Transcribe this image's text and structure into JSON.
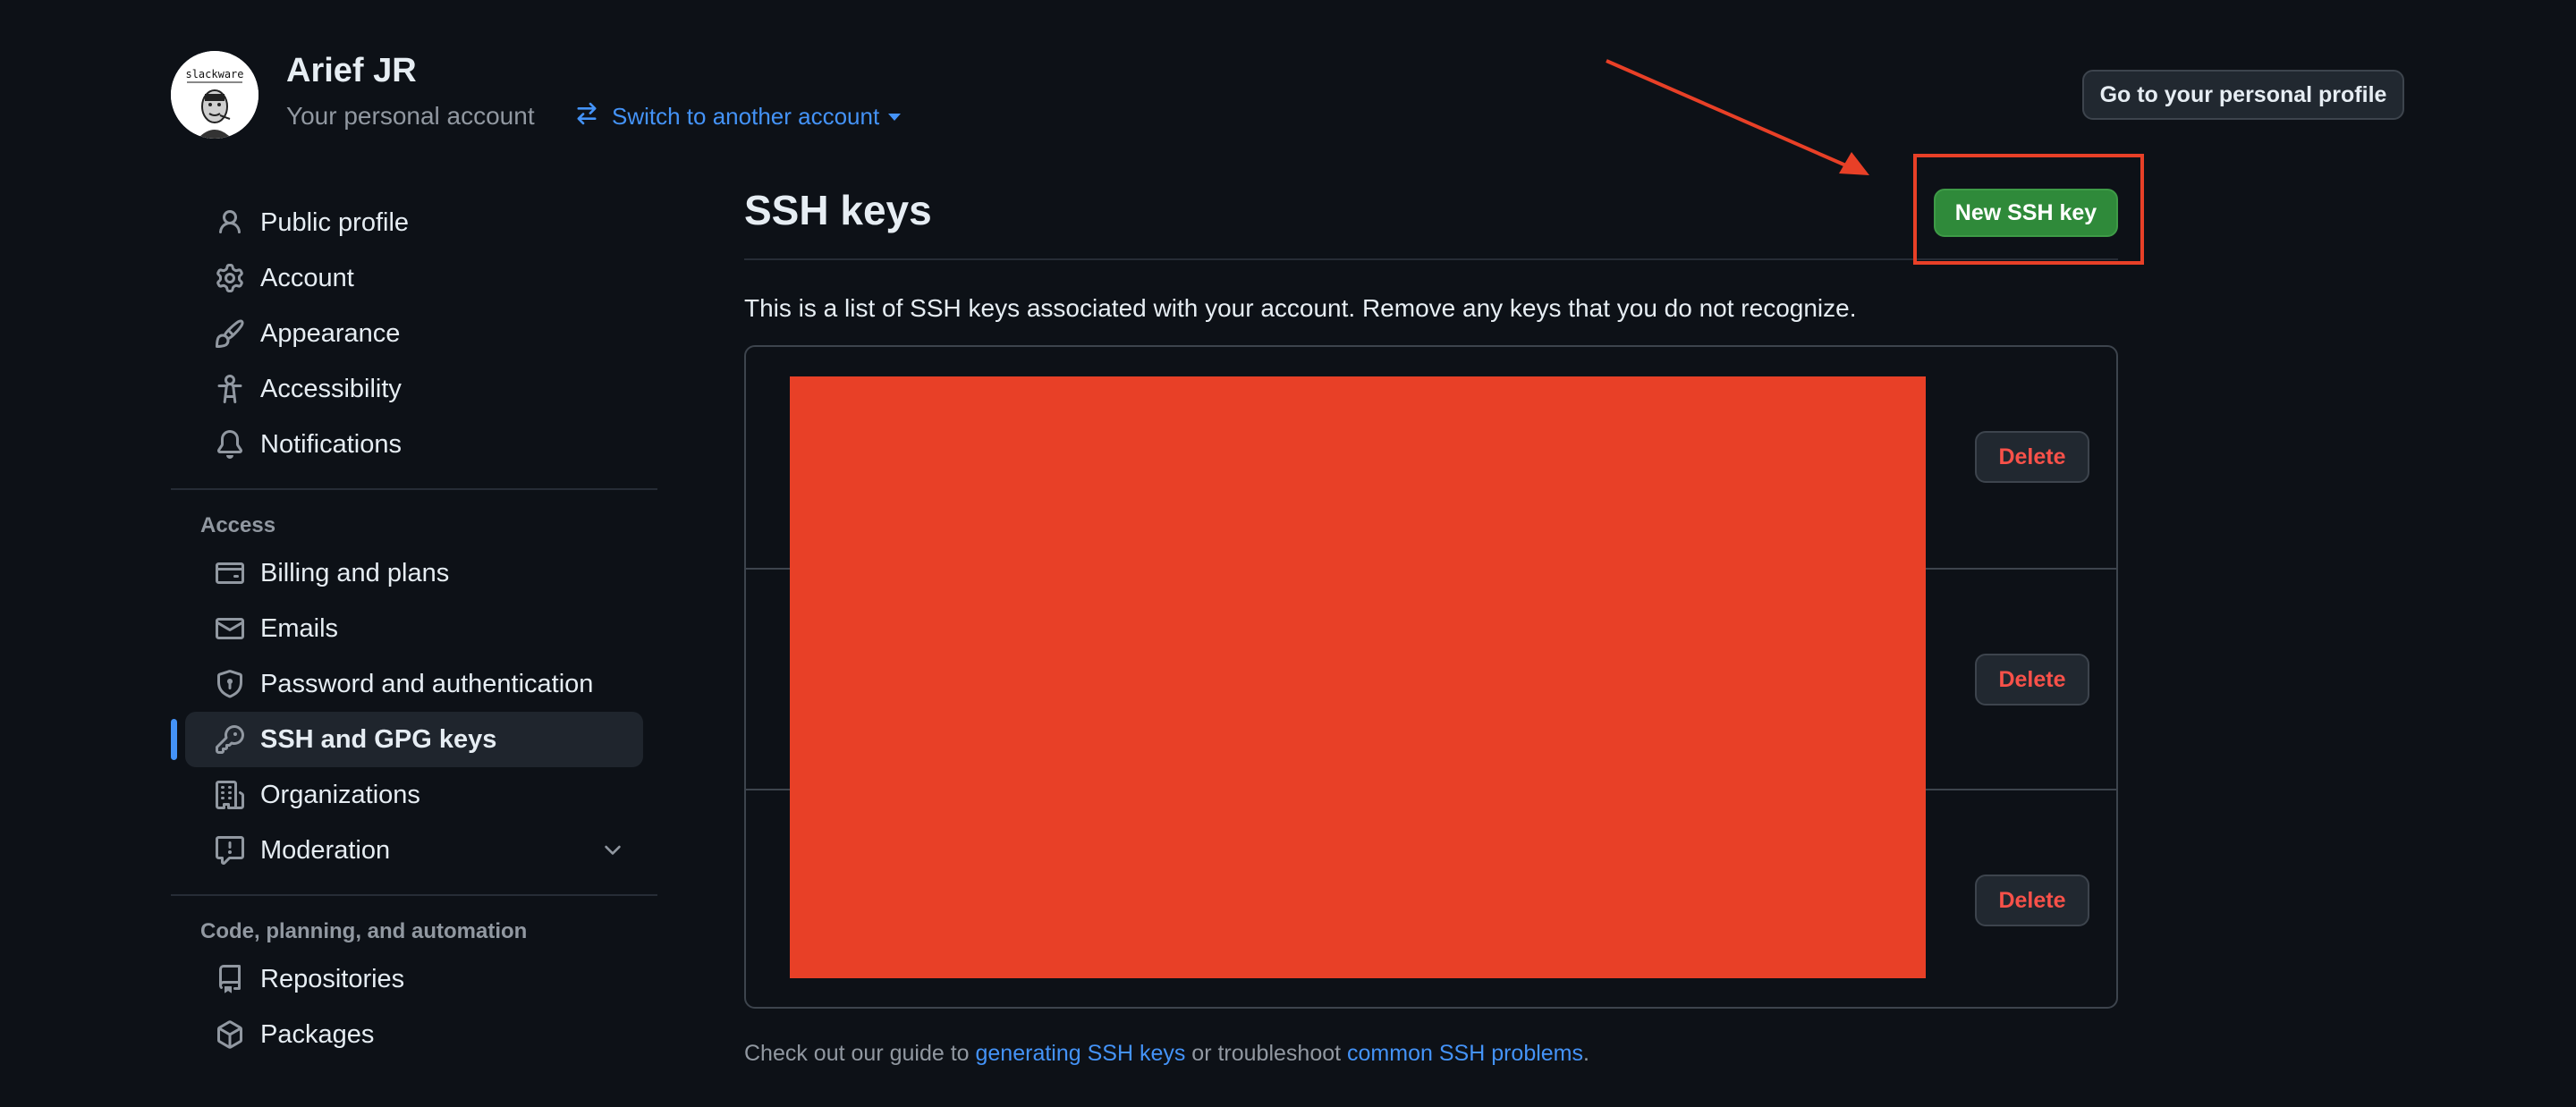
{
  "header": {
    "user_name": "Arief JR",
    "user_sub": "Your personal account",
    "switch_label": "Switch to another account",
    "profile_button": "Go to your personal profile",
    "avatar_text": "slackware"
  },
  "sidebar": {
    "group1": [
      {
        "label": "Public profile",
        "icon": "person-icon"
      },
      {
        "label": "Account",
        "icon": "gear-icon"
      },
      {
        "label": "Appearance",
        "icon": "paintbrush-icon"
      },
      {
        "label": "Accessibility",
        "icon": "accessibility-icon"
      },
      {
        "label": "Notifications",
        "icon": "bell-icon"
      }
    ],
    "access_heading": "Access",
    "group2": [
      {
        "label": "Billing and plans",
        "icon": "credit-card-icon"
      },
      {
        "label": "Emails",
        "icon": "mail-icon"
      },
      {
        "label": "Password and authentication",
        "icon": "shield-lock-icon"
      },
      {
        "label": "SSH and GPG keys",
        "icon": "key-icon",
        "active": true
      },
      {
        "label": "Organizations",
        "icon": "organization-icon"
      },
      {
        "label": "Moderation",
        "icon": "report-icon"
      }
    ],
    "code_heading": "Code, planning, and automation",
    "group3": [
      {
        "label": "Repositories",
        "icon": "repo-icon"
      },
      {
        "label": "Packages",
        "icon": "package-icon"
      }
    ]
  },
  "main": {
    "title": "SSH keys",
    "new_key_button": "New SSH key",
    "intro": "This is a list of SSH keys associated with your account. Remove any keys that you do not recognize.",
    "delete_label": "Delete",
    "footer_prefix": "Check out our guide to ",
    "footer_link1": "generating SSH keys",
    "footer_middle": " or troubleshoot ",
    "footer_link2": "common SSH problems",
    "footer_suffix": "."
  },
  "colors": {
    "background": "#0d1117",
    "accent": "#4493f8",
    "primary_button": "#2f8a3a",
    "danger": "#f85149",
    "annotation": "#e84027"
  }
}
